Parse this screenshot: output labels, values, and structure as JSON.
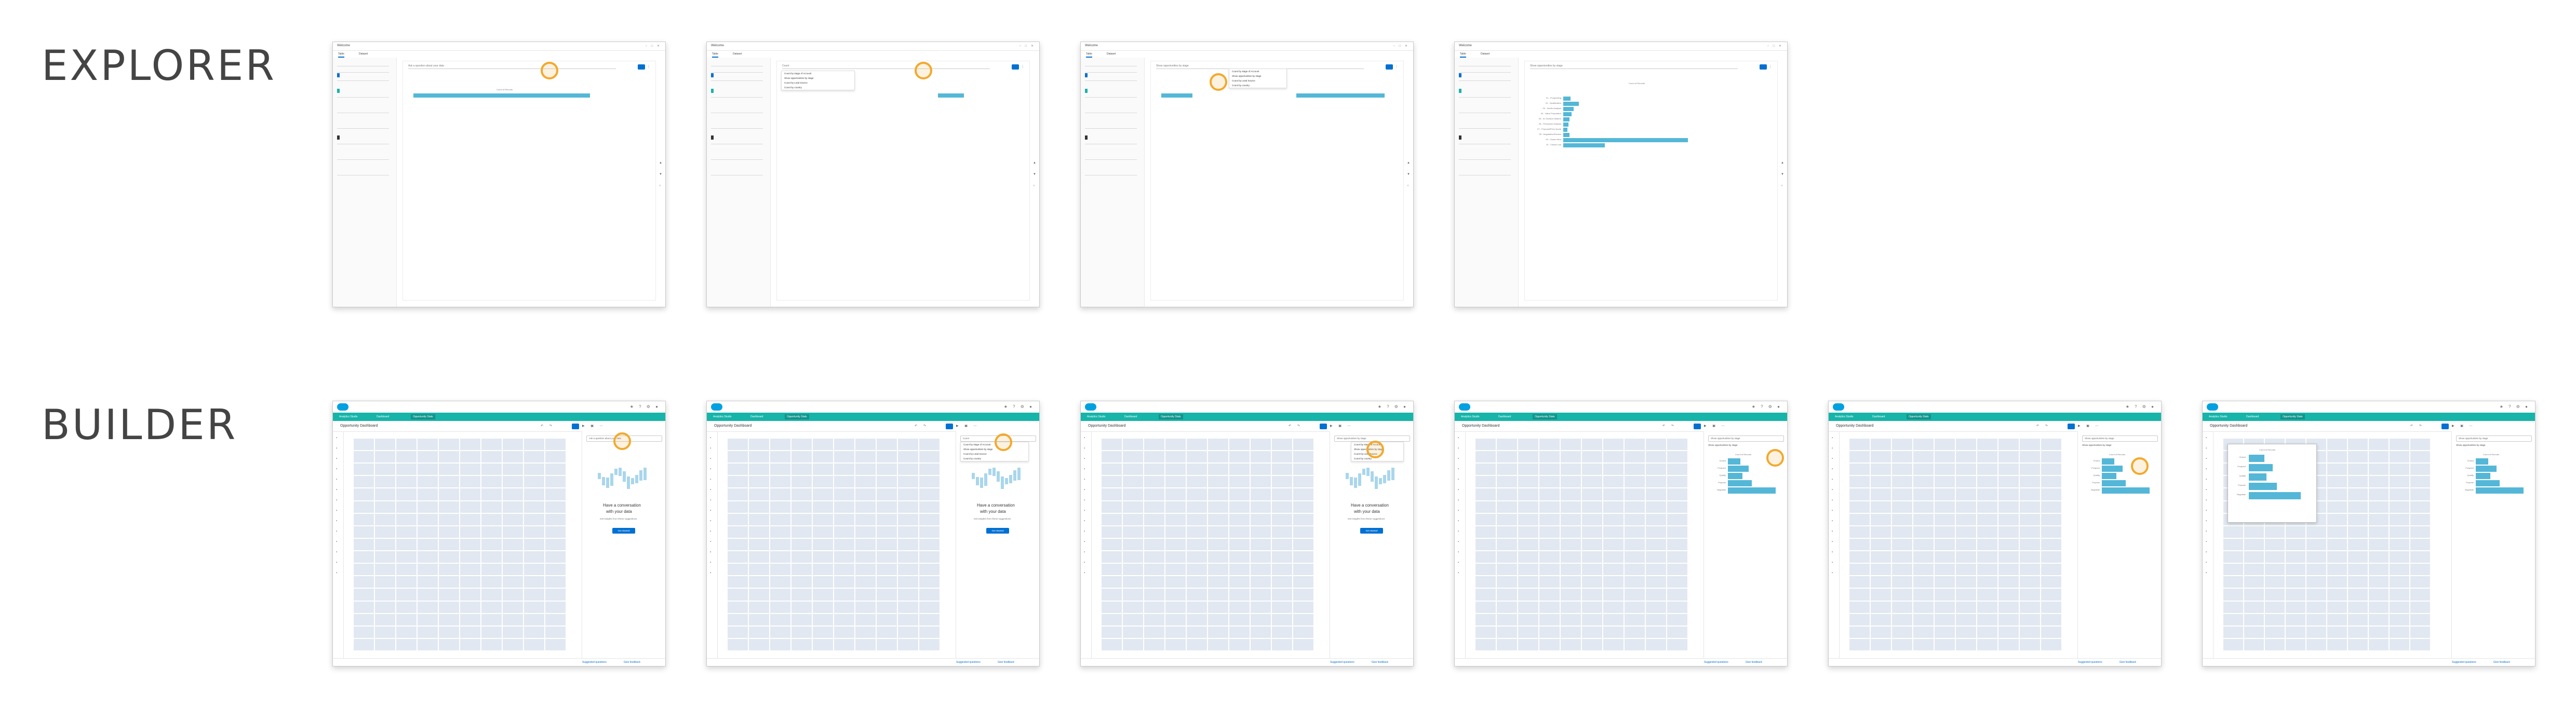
{
  "labels": {
    "explorer": "EXPLORER",
    "builder": "BUILDER"
  },
  "explorer": {
    "window_title": "Welcome",
    "tabs": [
      "Table",
      "Dataset"
    ],
    "search_placeholder": "Ask a question about your data",
    "query_typed": "Count",
    "query_partial": "Show opportunities by stage",
    "query_full": "Show opportunities by stage",
    "suggestions": [
      "Count by stage of Account",
      "Show opportunities by stage",
      "Count by Lead Source",
      "Count by country"
    ],
    "chart_title": "Count of Records",
    "bars_category": [
      "01 - Prospecting",
      "02 - Qualification",
      "03 - Needs Analysis",
      "04 - Value Proposition",
      "05 - Id. Decision Makers",
      "06 - Perception Analysis",
      "07 - Proposal/Price Quote",
      "08 - Negotiation/Review",
      "09 - Closed Won",
      "10 - Closed Lost"
    ]
  },
  "builder": {
    "tabs": [
      "Analytics Studio",
      "Dashboard",
      "Opportunity Stats"
    ],
    "dashboard_title": "Opportunity Dashboard",
    "ask_placeholder": "Ask a question about your data",
    "query_typed": "Count",
    "query_full": "Show opportunities by stage",
    "empty_heading": "Have a conversation",
    "empty_heading_2": "with your data",
    "empty_sub": "Get insights from these suggestions",
    "empty_button": "Get Started",
    "suggestions": [
      "Count by stage of Account",
      "Show opportunities by stage",
      "Count by Lead Source",
      "Count by country"
    ],
    "chart_title": "Count of Records",
    "footer_left": "Suggested questions",
    "footer_right": "Give feedback",
    "stage_labels": [
      "Closed",
      "Prospect",
      "Qualify",
      "Propose",
      "Negotiate"
    ]
  }
}
